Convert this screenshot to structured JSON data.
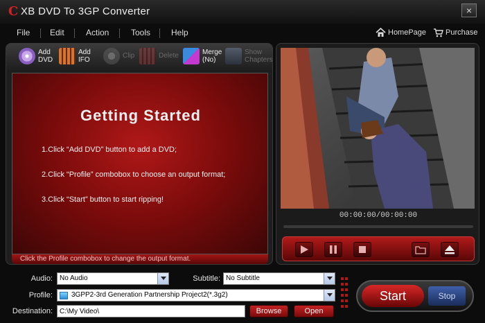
{
  "app": {
    "logo_letter": "C",
    "title": "XB DVD To 3GP Converter",
    "close_label": "×"
  },
  "menu": {
    "items": [
      "File",
      "Edit",
      "Action",
      "Tools",
      "Help"
    ],
    "homepage": "HomePage",
    "purchase": "Purchase"
  },
  "toolbar": {
    "add_dvd": "Add\nDVD",
    "add_ifo": "Add\nIFO",
    "clip": "Clip",
    "delete": "Delete",
    "merge": "Merge\n(No)",
    "show_chapters": "Show\nChapters"
  },
  "getting_started": {
    "title": "Getting  Started",
    "steps": [
      "1.Click “Add DVD” button to add a DVD;",
      "2.Click “Profile” combobox to choose an output format;",
      "3.Click “Start” button to start ripping!"
    ]
  },
  "status": {
    "hint": "Click the Profile combobox to change the output format."
  },
  "preview": {
    "time": "00:00:00/00:00:00"
  },
  "settings": {
    "audio_label": "Audio:",
    "audio_value": "No Audio",
    "subtitle_label": "Subtitle:",
    "subtitle_value": "No Subtitle",
    "profile_label": "Profile:",
    "profile_value": "3GPP2-3rd Generation Partnership Project2(*.3g2)",
    "destination_label": "Destination:",
    "destination_value": "C:\\My Video\\",
    "browse_label": "Browse",
    "open_label": "Open"
  },
  "actions": {
    "start_label": "Start",
    "stop_label": "Stop"
  },
  "colors": {
    "accent_red": "#b01818",
    "background": "#0c0c0c"
  }
}
